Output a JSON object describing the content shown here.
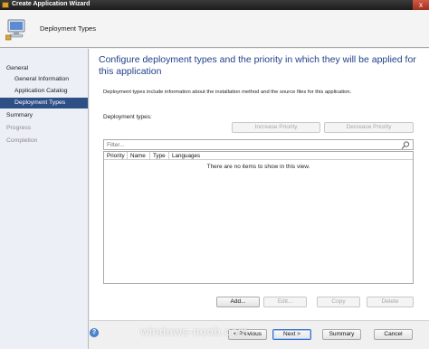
{
  "window": {
    "title": "Create Application Wizard",
    "close_glyph": "x"
  },
  "header": {
    "title": "Deployment Types"
  },
  "nav": {
    "items": [
      {
        "label": "General",
        "state": "normal"
      },
      {
        "label": "General Information",
        "state": "normal"
      },
      {
        "label": "Application Catalog",
        "state": "normal"
      },
      {
        "label": "Deployment Types",
        "state": "active"
      },
      {
        "label": "Summary",
        "state": "normal"
      },
      {
        "label": "Progress",
        "state": "disabled"
      },
      {
        "label": "Completion",
        "state": "disabled"
      }
    ]
  },
  "main": {
    "heading": "Configure deployment types and the priority in which they will be applied for this application",
    "description": "Deployment types include information about the installation method and the source files for this application.",
    "deployment_types_label": "Deployment types:",
    "increase_priority": "Increase Priority",
    "decrease_priority": "Decrease Priority",
    "filter_placeholder": "Filter...",
    "columns": [
      "Priority",
      "Name",
      "Type",
      "Languages"
    ],
    "empty_message": "There are no items to show in this view.",
    "add": "Add...",
    "edit": "Edit...",
    "copy": "Copy",
    "delete": "Delete"
  },
  "footer": {
    "previous": "< Previous",
    "next": "Next >",
    "summary": "Summary",
    "cancel": "Cancel"
  },
  "watermark": "windows-noob.com",
  "colors": {
    "accent": "#2e4f86",
    "heading": "#1f3f8a",
    "nav_bg": "#ecf0f6"
  }
}
